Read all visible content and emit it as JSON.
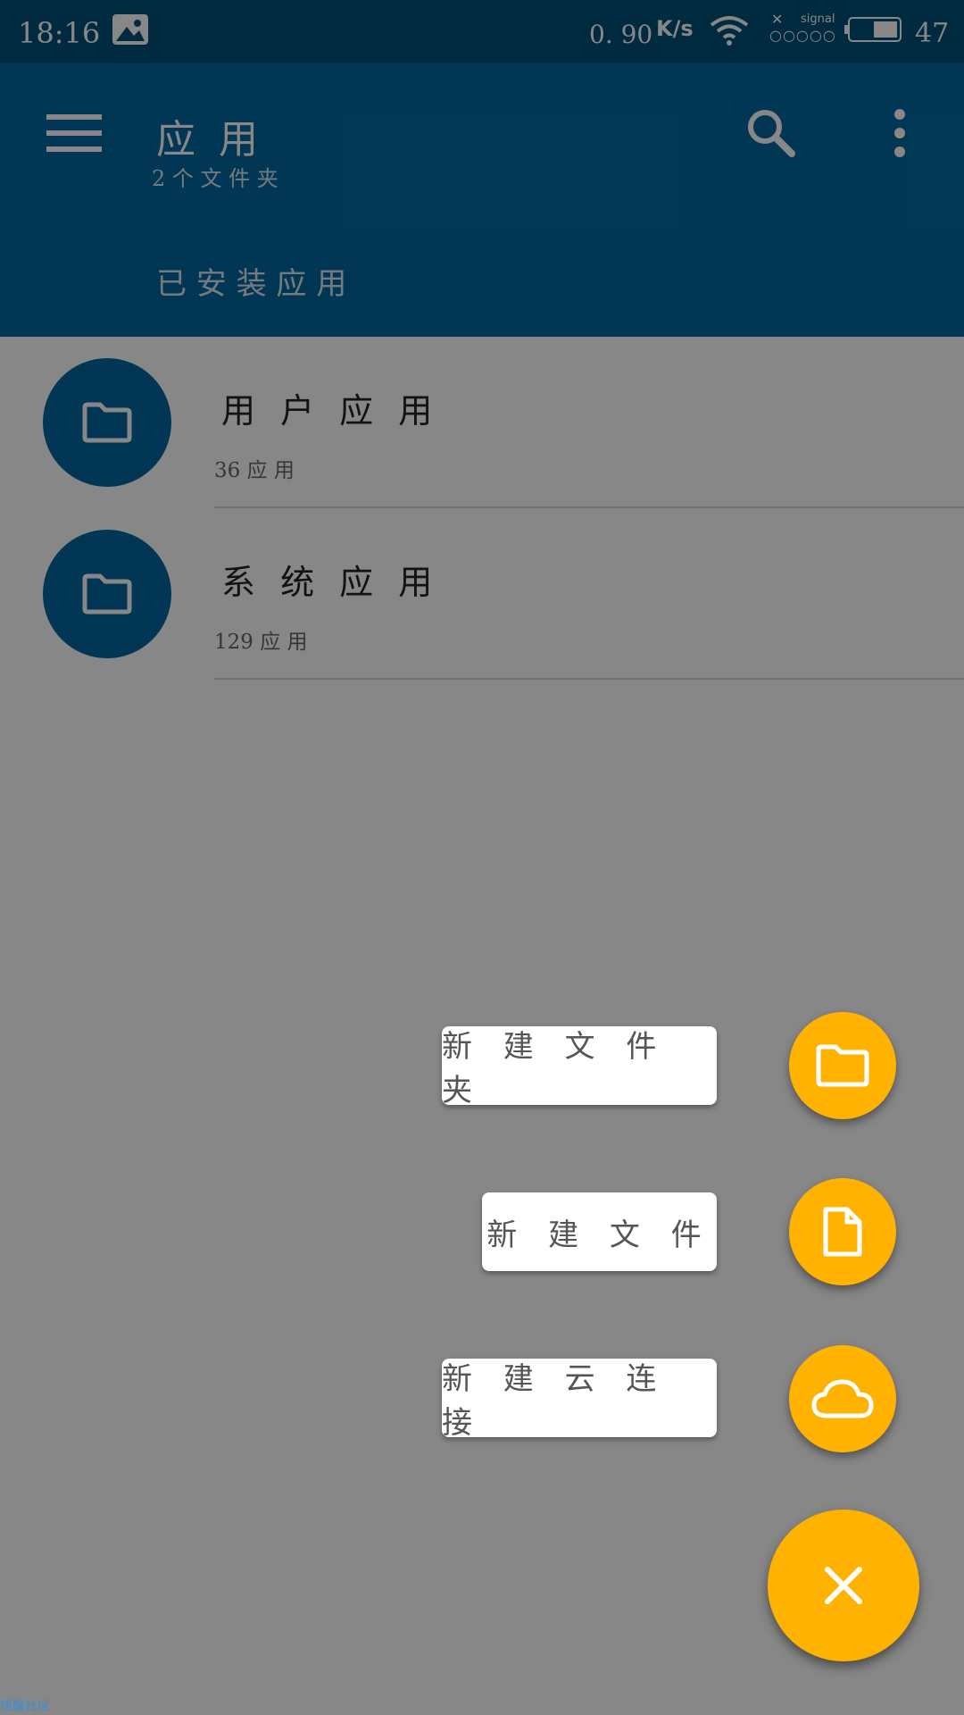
{
  "status_bar": {
    "time": "18:16",
    "network_speed": "0. 90",
    "network_unit": "K/s",
    "signal_label": "signal",
    "signal_dots": "○○○○○",
    "battery": "47"
  },
  "app_bar": {
    "title": "应 用",
    "subtitle": "2 个 文 件 夹",
    "section_label": "已 安 装 应 用"
  },
  "folders": [
    {
      "name": "用 户 应 用",
      "count": "36 应 用"
    },
    {
      "name": "系 统 应 用",
      "count": "129 应 用"
    }
  ],
  "fab_menu": {
    "new_folder_label": "新 建 文 件 夹",
    "new_file_label": "新 建 文 件",
    "new_cloud_label": "新 建 云 连 接"
  },
  "watermark": "悟醒社区",
  "colors": {
    "primary": "#0269a1",
    "status_bar": "#01507a",
    "accent": "#ffb300"
  }
}
